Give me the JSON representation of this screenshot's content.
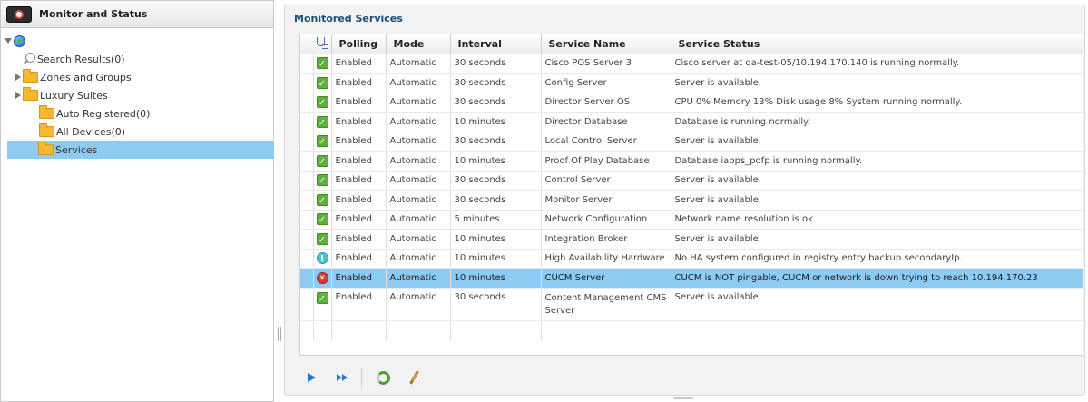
{
  "left_panel": {
    "title": "Monitor and Status",
    "tree": {
      "search_results": "Search Results(0)",
      "zones_and_groups": "Zones and Groups",
      "luxury_suites": "Luxury Suites",
      "auto_registered": "Auto Registered(0)",
      "all_devices": "All Devices(0)",
      "services": "Services",
      "selected": "Services"
    }
  },
  "main": {
    "title": "Monitored Services",
    "columns": {
      "polling": "Polling",
      "mode": "Mode",
      "interval": "Interval",
      "service_name": "Service Name",
      "service_status": "Service Status"
    },
    "rows": [
      {
        "status": "ok",
        "polling": "Enabled",
        "mode": "Automatic",
        "interval": "30 seconds",
        "name": "Cisco POS Server 3",
        "status_text": "Cisco server at qa-test-05/10.194.170.140 is running normally."
      },
      {
        "status": "ok",
        "polling": "Enabled",
        "mode": "Automatic",
        "interval": "30 seconds",
        "name": "Config Server",
        "status_text": "Server is available."
      },
      {
        "status": "ok",
        "polling": "Enabled",
        "mode": "Automatic",
        "interval": "30 seconds",
        "name": "Director Server OS",
        "status_text": "CPU 0% Memory 13% Disk usage 8% System running normally."
      },
      {
        "status": "ok",
        "polling": "Enabled",
        "mode": "Automatic",
        "interval": "10 minutes",
        "name": "Director Database",
        "status_text": "Database is running normally."
      },
      {
        "status": "ok",
        "polling": "Enabled",
        "mode": "Automatic",
        "interval": "30 seconds",
        "name": "Local Control Server",
        "status_text": "Server is available."
      },
      {
        "status": "ok",
        "polling": "Enabled",
        "mode": "Automatic",
        "interval": "10 minutes",
        "name": "Proof Of Play Database",
        "status_text": "Database iapps_pofp is running normally."
      },
      {
        "status": "ok",
        "polling": "Enabled",
        "mode": "Automatic",
        "interval": "30 seconds",
        "name": "Control Server",
        "status_text": "Server is available."
      },
      {
        "status": "ok",
        "polling": "Enabled",
        "mode": "Automatic",
        "interval": "30 seconds",
        "name": "Monitor Server",
        "status_text": "Server is available."
      },
      {
        "status": "ok",
        "polling": "Enabled",
        "mode": "Automatic",
        "interval": "5 minutes",
        "name": "Network Configuration",
        "status_text": "Network name resolution is ok."
      },
      {
        "status": "ok",
        "polling": "Enabled",
        "mode": "Automatic",
        "interval": "10 minutes",
        "name": "Integration Broker",
        "status_text": "Server is available."
      },
      {
        "status": "warn",
        "polling": "Enabled",
        "mode": "Automatic",
        "interval": "10 minutes",
        "name": "High Availability Hardware",
        "status_text": "No HA system configured in registry entry backup.secondaryIp."
      },
      {
        "status": "error",
        "polling": "Enabled",
        "mode": "Automatic",
        "interval": "10 minutes",
        "name": "CUCM Server",
        "status_text": "CUCM is NOT pingable, CUCM or network is down trying to reach 10.194.170.23",
        "selected": true
      },
      {
        "status": "ok",
        "polling": "Enabled",
        "mode": "Automatic",
        "interval": "30 seconds",
        "name": "Content Management CMS Server",
        "status_text": "Server is available."
      }
    ]
  },
  "toolbar": {
    "icons": [
      "play-icon",
      "fast-forward-icon",
      "refresh-icon",
      "edit-icon"
    ]
  },
  "colors": {
    "selection": "#8ecbf3",
    "title_blue": "#1c4e78",
    "ok_green": "#5db03c",
    "warn_cyan": "#4cc3d0",
    "error_red": "#d73a3a"
  }
}
